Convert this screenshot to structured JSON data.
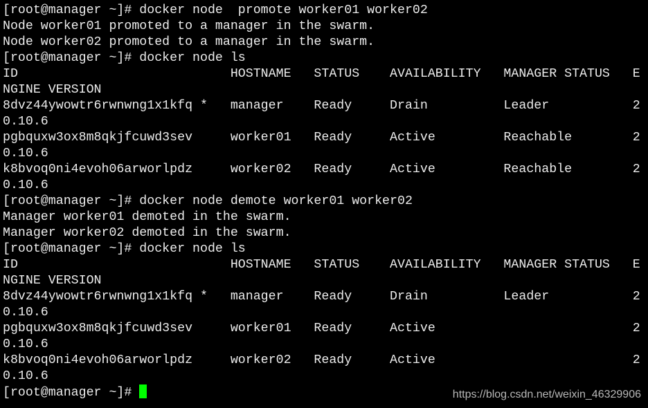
{
  "terminal": {
    "lines": [
      "[root@manager ~]# docker node  promote worker01 worker02",
      "Node worker01 promoted to a manager in the swarm.",
      "Node worker02 promoted to a manager in the swarm.",
      "[root@manager ~]# docker node ls",
      "ID                            HOSTNAME   STATUS    AVAILABILITY   MANAGER STATUS   E",
      "NGINE VERSION",
      "8dvz44ywowtr6rwnwng1x1kfq *   manager    Ready     Drain          Leader           2",
      "0.10.6",
      "pgbquxw3ox8m8qkjfcuwd3sev     worker01   Ready     Active         Reachable        2",
      "0.10.6",
      "k8bvoq0ni4evoh06arworlpdz     worker02   Ready     Active         Reachable        2",
      "0.10.6",
      "[root@manager ~]# docker node demote worker01 worker02",
      "Manager worker01 demoted in the swarm.",
      "Manager worker02 demoted in the swarm.",
      "[root@manager ~]# docker node ls",
      "ID                            HOSTNAME   STATUS    AVAILABILITY   MANAGER STATUS   E",
      "NGINE VERSION",
      "8dvz44ywowtr6rwnwng1x1kfq *   manager    Ready     Drain          Leader           2",
      "0.10.6",
      "pgbquxw3ox8m8qkjfcuwd3sev     worker01   Ready     Active                          2",
      "0.10.6",
      "k8bvoq0ni4evoh06arworlpdz     worker02   Ready     Active                          2",
      "0.10.6"
    ],
    "prompt": "[root@manager ~]# ",
    "cursor_color": "#00ff00"
  },
  "watermark": "https://blog.csdn.net/weixin_46329906"
}
